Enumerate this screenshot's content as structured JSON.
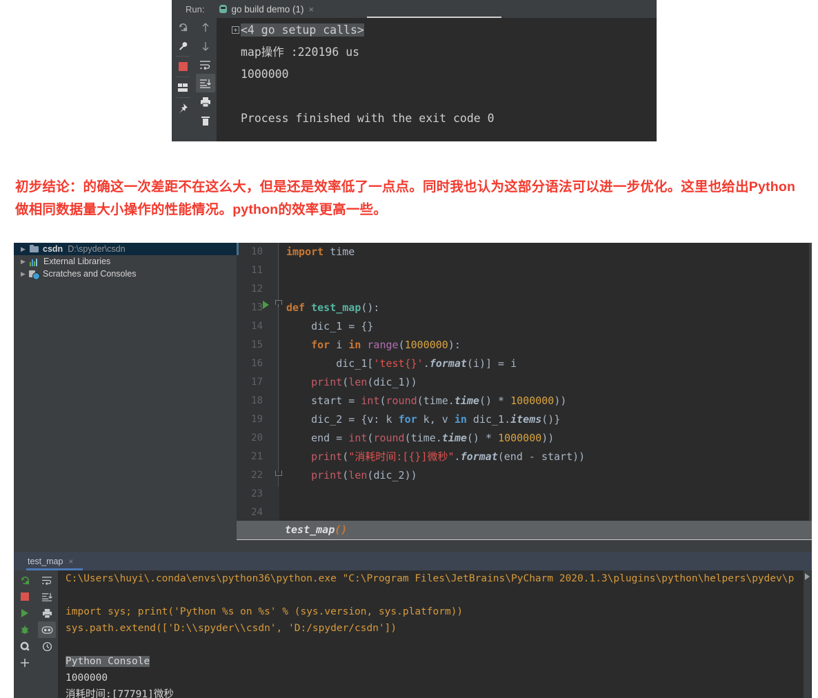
{
  "run_panel": {
    "label": "Run:",
    "tab_title": "go build demo (1)",
    "tab_close": "×",
    "toolbar_left": [
      "rerun-icon",
      "wrench-icon",
      "stop-icon",
      "layout-icon",
      "pin-icon"
    ],
    "toolbar_right": [
      "scroll-up-icon",
      "scroll-down-icon",
      "soft-wrap-icon",
      "scroll-to-end-icon",
      "print-icon",
      "trash-icon"
    ],
    "output_lines": [
      {
        "fold": true,
        "text": "<4 go setup calls>",
        "highlight": true
      },
      {
        "fold": false,
        "text": "map操作 :220196 us",
        "highlight": false
      },
      {
        "fold": false,
        "text": "1000000",
        "highlight": false
      },
      {
        "fold": false,
        "text": "",
        "highlight": false
      },
      {
        "fold": false,
        "text": "Process finished with the exit code 0",
        "highlight": false
      }
    ]
  },
  "annotation": {
    "color": "#f23a2e",
    "text": "初步结论：的确这一次差距不在这么大，但是还是效率低了一点点。同时我也认为这部分语法可以进一步优化。这里也给出Python做相同数据量大小操作的性能情况。python的效率更高一些。"
  },
  "project_tree": {
    "items": [
      {
        "arrow": "▶",
        "icon": "folder-icon",
        "name": "csdn",
        "path": "D:\\spyder\\csdn",
        "selected": true
      },
      {
        "arrow": "▶",
        "icon": "library-icon",
        "name": "External Libraries",
        "path": "",
        "selected": false
      },
      {
        "arrow": "▶",
        "icon": "scratches-icon",
        "name": "Scratches and Consoles",
        "path": "",
        "selected": false
      }
    ]
  },
  "editor": {
    "line_numbers": [
      "10",
      "11",
      "12",
      "13",
      "14",
      "15",
      "16",
      "17",
      "18",
      "19",
      "20",
      "21",
      "22",
      "23",
      "24"
    ],
    "code_lines": [
      "import time",
      "",
      "",
      "def test_map():",
      "    dic_1 = {}",
      "    for i in range(1000000):",
      "        dic_1['test{}'.format(i)] = i",
      "    print(len(dic_1))",
      "    start = int(round(time.time() * 1000000))",
      "    dic_2 = {v: k for k, v in dic_1.items()}",
      "    end = int(round(time.time() * 1000000))",
      "    print(\"消耗时间:[{}]微秒\".format(end - start))",
      "    print(len(dic_2))",
      "",
      ""
    ],
    "breadcrumb": "test_map()",
    "gutter_run_line": "13"
  },
  "console": {
    "tab_label": "test_map",
    "tab_close": "×",
    "toolbar_left": [
      "rerun-icon",
      "stop-icon",
      "run-icon",
      "debug-icon",
      "settings-icon",
      "plus-icon"
    ],
    "toolbar_right": [
      "soft-wrap-icon",
      "scroll-to-end-icon",
      "print-icon",
      "variables-icon",
      "history-icon"
    ],
    "output": [
      {
        "text": "C:\\Users\\huyi\\.conda\\envs\\python36\\python.exe \"C:\\Program Files\\JetBrains\\PyCharm 2020.1.3\\plugins\\python\\helpers\\pydev\\p",
        "style": "orange"
      },
      {
        "text": "",
        "style": "orange"
      },
      {
        "text": "import sys; print('Python %s on %s' % (sys.version, sys.platform))",
        "style": "orange"
      },
      {
        "text": "sys.path.extend(['D:\\\\spyder\\\\csdn', 'D:/spyder/csdn'])",
        "style": "orange"
      },
      {
        "text": "",
        "style": "orange"
      },
      {
        "text": "Python Console",
        "style": "highlight"
      },
      {
        "text": "1000000",
        "style": "white"
      },
      {
        "text": "消耗时间:[77791]微秒",
        "style": "white"
      }
    ]
  }
}
